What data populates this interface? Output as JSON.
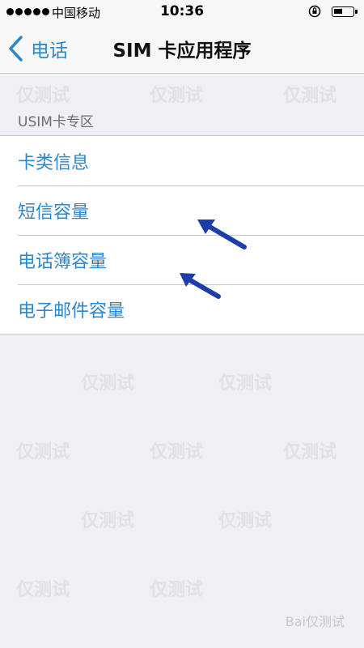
{
  "status_bar": {
    "carrier": "中国移动",
    "time": "10:36",
    "signal_bars": 5
  },
  "nav": {
    "back_label": "电话",
    "title": "SIM 卡应用程序"
  },
  "section": {
    "header": "USIM卡专区",
    "items": [
      {
        "label": "卡类信息"
      },
      {
        "label": "短信容量"
      },
      {
        "label": "电话簿容量"
      },
      {
        "label": "电子邮件容量"
      }
    ]
  },
  "watermark": {
    "text": "仅测试",
    "brand": "Bai仅测试"
  },
  "colors": {
    "accent": "#2f86c8",
    "background": "#efeff4",
    "arrow": "#1d3ea8"
  }
}
